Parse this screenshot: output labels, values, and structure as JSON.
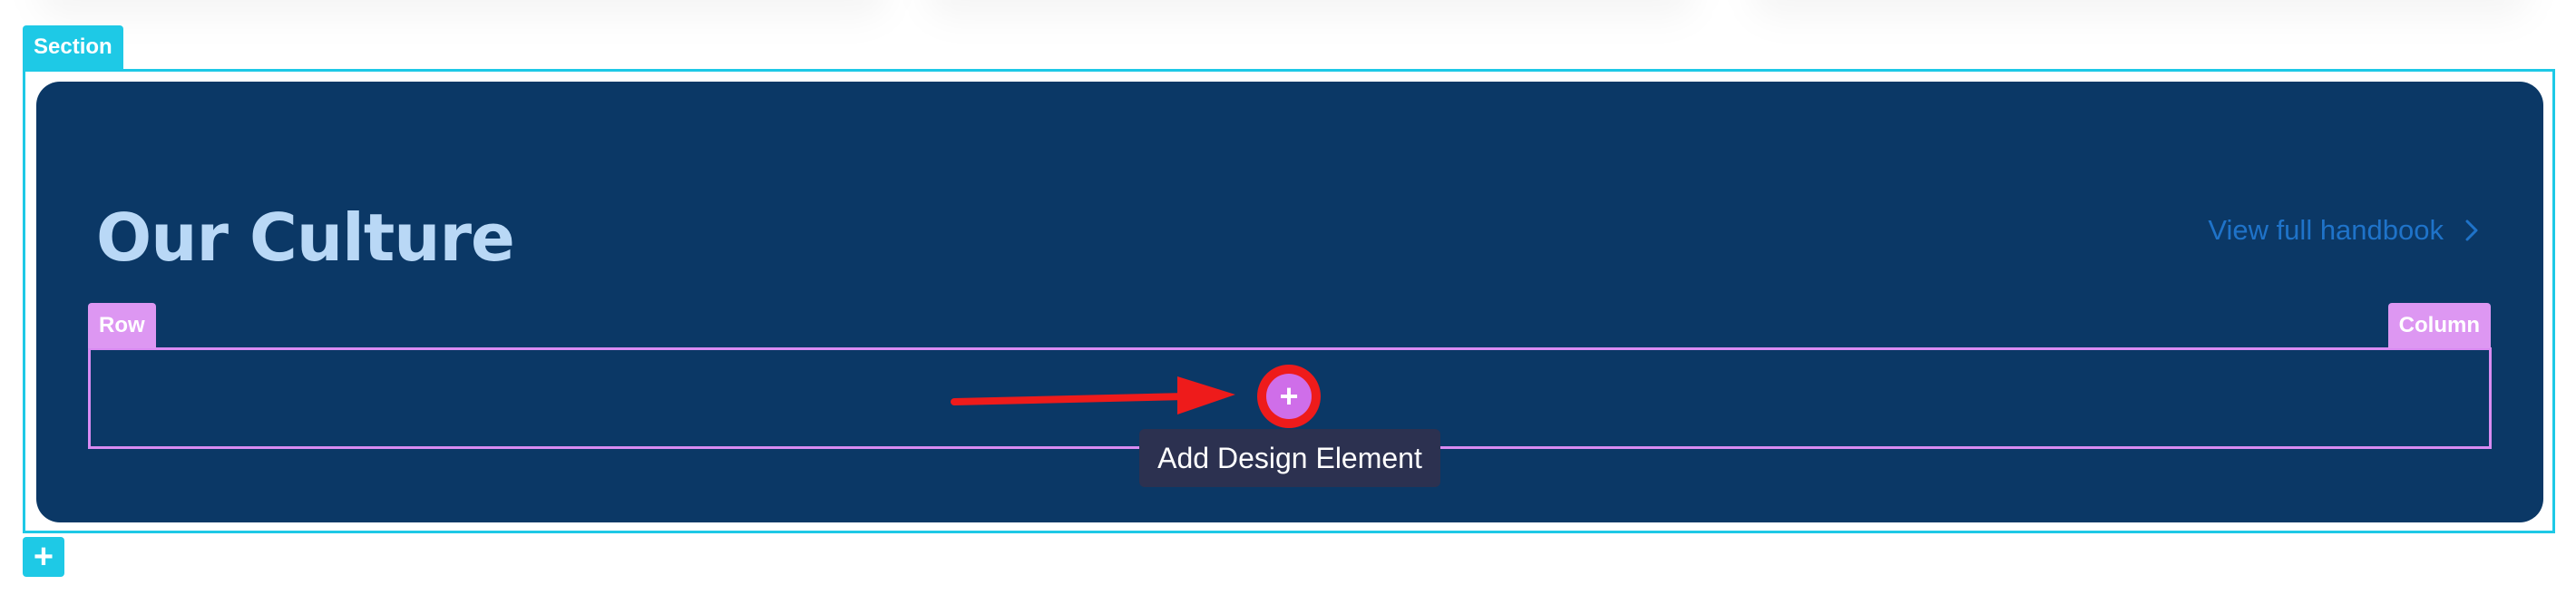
{
  "builder": {
    "section_label": "Section",
    "row_label": "Row",
    "column_label": "Column",
    "add_element_symbol": "+",
    "add_element_tooltip": "Add Design Element",
    "add_section_symbol": "+"
  },
  "content": {
    "heading": "Our Culture",
    "handbook_link": "View full handbook"
  },
  "icons": {
    "handbook_link_icon": "chevron-right-icon",
    "annotation": "arrow-right-icon"
  },
  "colors": {
    "section_accent": "#1ec9e6",
    "row_accent": "#dd97f2",
    "panel_background": "#0b3866",
    "heading": "#b9d8f6",
    "link": "#1f73c9",
    "annotation": "#ee1b1b",
    "tooltip_background": "#2c3150"
  }
}
